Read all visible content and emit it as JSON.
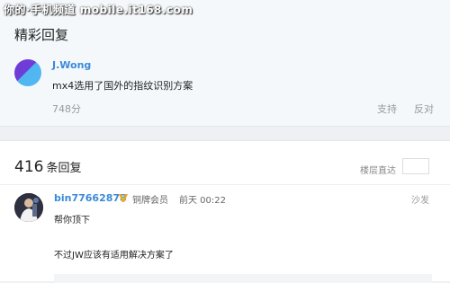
{
  "watermark": "你的·手机频道 mobile.it168.com",
  "highlight_section": {
    "title": "精彩回复",
    "comment": {
      "username": "J.Wong",
      "text": "mx4选用了国外的指纹识别方案",
      "score": "748分",
      "support_label": "支持",
      "oppose_label": "反对"
    }
  },
  "replies_section": {
    "count": "416",
    "count_label": "条回复",
    "jump_label": "楼层直达",
    "jump_input_value": "",
    "reply": {
      "username": "bin77662878",
      "badge_icon": "v-verified-icon",
      "member_level": "铜牌会员",
      "time": "前天 00:22",
      "floor_label": "沙发",
      "line1": "帮你顶下",
      "line2": "不过JW应该有适用解决方案了"
    }
  },
  "colors": {
    "link": "#3b8ad9",
    "vip_gold": "#f0a81c",
    "logo_purple": "#6f3cd8",
    "logo_blue": "#4fb5f0"
  }
}
